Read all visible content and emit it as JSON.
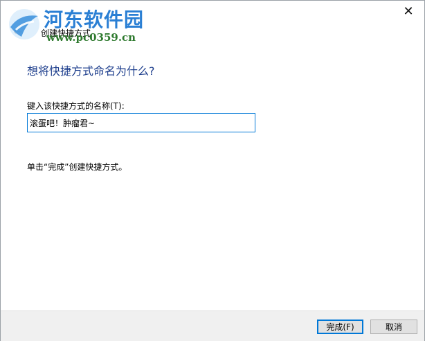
{
  "titlebar": {
    "title": "创建快捷方式",
    "close_glyph": "✕",
    "back_glyph": "←"
  },
  "watermark": {
    "name": "河东软件园",
    "url": "www.pc0359.cn"
  },
  "main": {
    "heading": "想将快捷方式命名为什么?",
    "field_label": "键入该快捷方式的名称(T):",
    "name_value": "滚蛋吧！肿瘤君~",
    "hint": "单击“完成”创建快捷方式。"
  },
  "footer": {
    "finish_label": "完成(F)",
    "cancel_label": "取消"
  },
  "colors": {
    "accent": "#0078d7",
    "heading": "#1c3d8c",
    "watermark_blue": "#2a7fd4",
    "watermark_green": "#2f7a2f"
  },
  "icons": [
    "close-icon",
    "back-arrow-icon",
    "watermark-logo-icon"
  ]
}
